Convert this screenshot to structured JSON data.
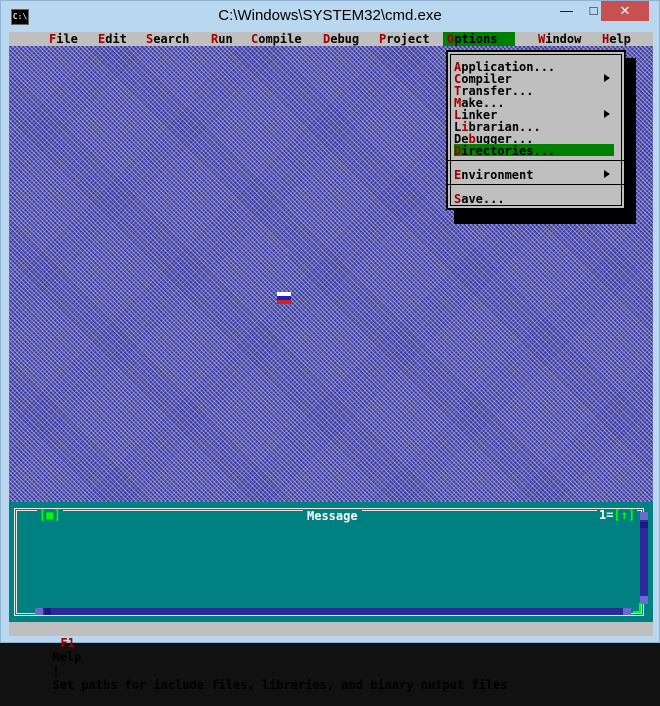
{
  "window": {
    "title": "C:\\Windows\\SYSTEM32\\cmd.exe",
    "icon_text": "C:\\",
    "minimize_glyph": "—",
    "maximize_glyph": "□",
    "close_glyph": "✕"
  },
  "menubar": {
    "items": [
      {
        "hotkey": "≡",
        "rest": "",
        "label": "system-menu"
      },
      {
        "hotkey": "F",
        "rest": "ile"
      },
      {
        "hotkey": "E",
        "rest": "dit"
      },
      {
        "hotkey": "S",
        "rest": "earch"
      },
      {
        "hotkey": "R",
        "rest": "un"
      },
      {
        "hotkey": "C",
        "rest": "ompile"
      },
      {
        "hotkey": "D",
        "rest": "ebug"
      },
      {
        "hotkey": "P",
        "rest": "roject"
      },
      {
        "hotkey": "O",
        "rest": "ptions"
      },
      {
        "hotkey": "W",
        "rest": "indow"
      },
      {
        "hotkey": "H",
        "rest": "elp"
      }
    ],
    "active_item": "Options"
  },
  "options_menu": {
    "items": [
      {
        "hotkey": "A",
        "rest": "pplication...",
        "submenu": false
      },
      {
        "hotkey": "C",
        "rest": "ompiler",
        "submenu": true
      },
      {
        "hotkey": "T",
        "rest": "ransfer...",
        "submenu": false
      },
      {
        "hotkey": "M",
        "rest": "ake...",
        "submenu": false
      },
      {
        "hotkey": "L",
        "rest": "inker",
        "submenu": true
      },
      {
        "pre": "L",
        "hotkey": "i",
        "rest": "brarian...",
        "submenu": false
      },
      {
        "pre": "De",
        "hotkey": "b",
        "rest": "ugger...",
        "submenu": false
      },
      {
        "hotkey": "D",
        "rest": "irectories...",
        "submenu": false,
        "selected": true
      },
      {
        "hotkey": "E",
        "rest": "nvironment",
        "submenu": true
      },
      {
        "hotkey": "S",
        "rest": "ave...",
        "submenu": false
      }
    ]
  },
  "message_window": {
    "title": "Message",
    "close_box": "[■]",
    "window_number": "1",
    "zoom_box": "[↑]"
  },
  "statusbar": {
    "key": "F1",
    "key_label": "Help",
    "separator": "|",
    "hint": "Set paths for include files, libraries, and binary output files"
  },
  "colors": {
    "menu_bg": "#bfbfbf",
    "hotkey_red": "#a00000",
    "highlight_green": "#008000",
    "message_teal": "#008080",
    "desktop_blue": "#3a3aa0"
  }
}
